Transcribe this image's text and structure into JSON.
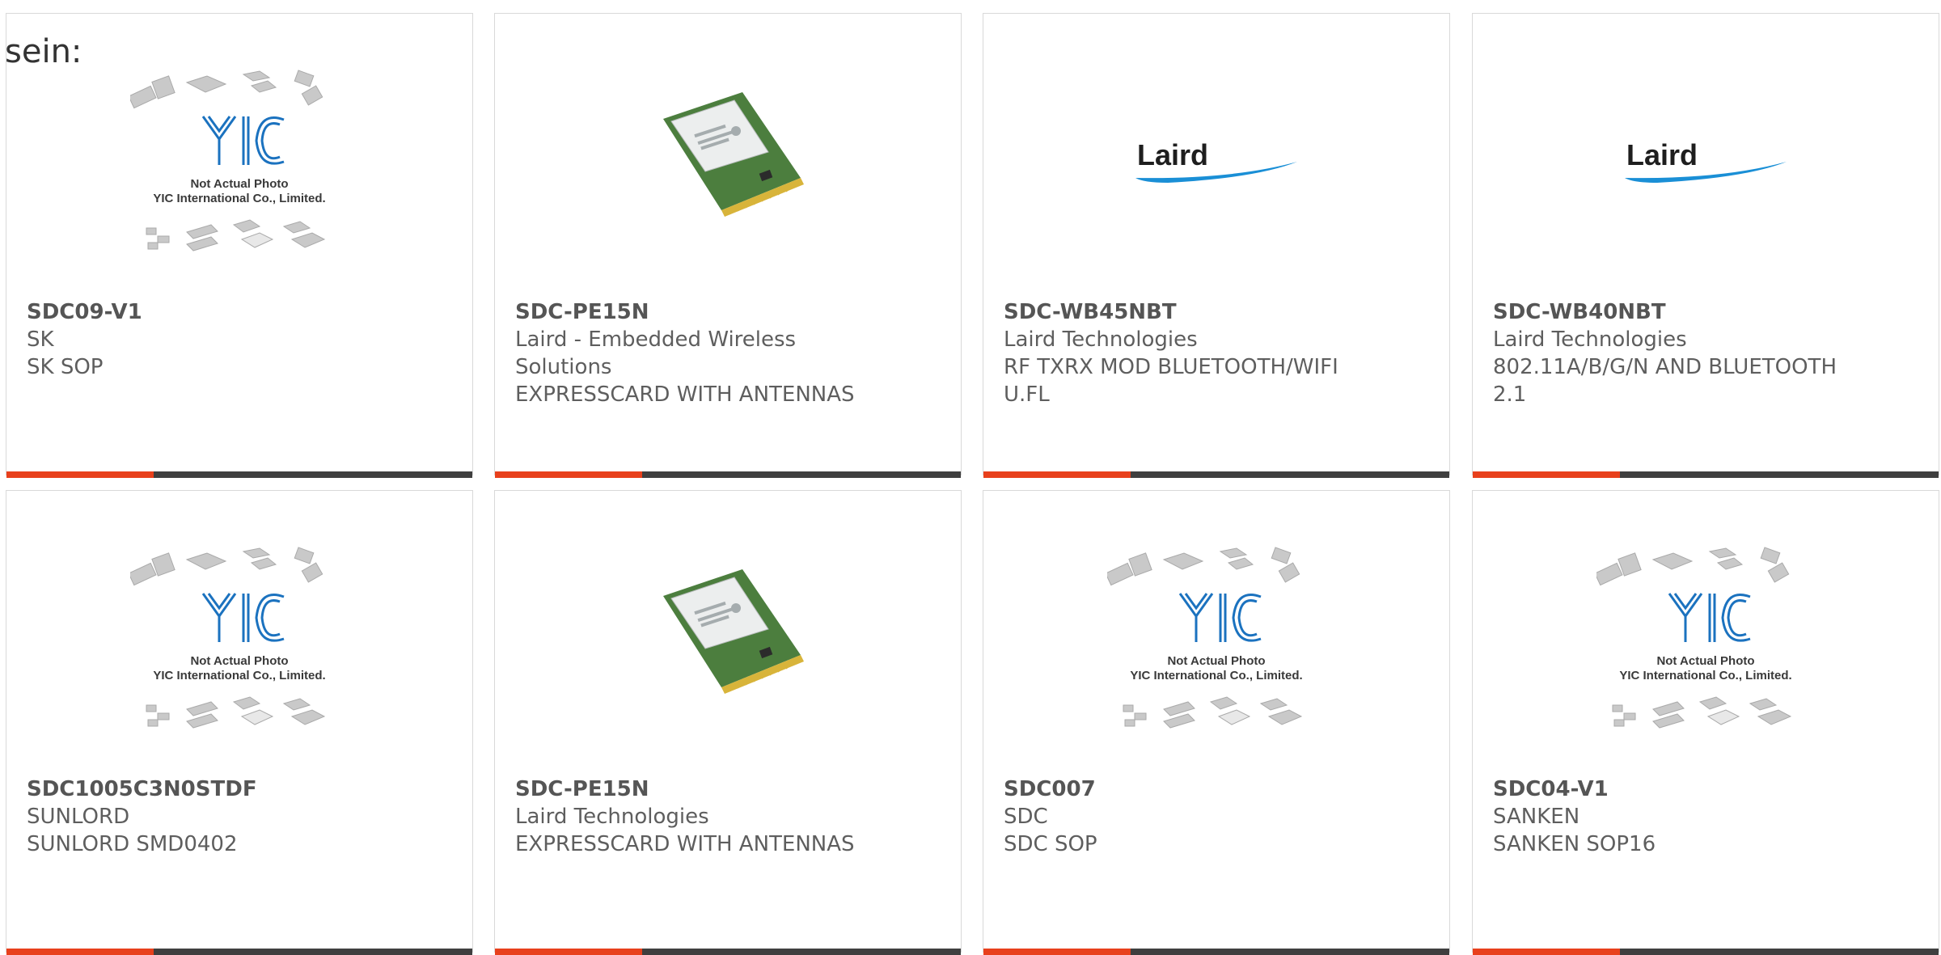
{
  "intro_text": "sein:",
  "colors": {
    "accent": "#e8401c",
    "bar_dark": "#3f3f3f",
    "yic_blue": "#1b72bf"
  },
  "placeholder_caption": [
    "Not Actual Photo",
    "YIC International Co., Limited."
  ],
  "laird_wordmark": "Laird",
  "products": [
    {
      "part": "SDC09-V1",
      "lines": [
        "SK",
        "SK SOP"
      ],
      "image": "yic-placeholder"
    },
    {
      "part": "SDC-PE15N",
      "lines": [
        "Laird - Embedded Wireless",
        "Solutions",
        "EXPRESSCARD WITH ANTENNAS"
      ],
      "image": "module-card-photo"
    },
    {
      "part": "SDC-WB45NBT",
      "lines": [
        "Laird Technologies",
        "RF TXRX MOD BLUETOOTH/WIFI",
        "U.FL"
      ],
      "image": "laird-logo"
    },
    {
      "part": "SDC-WB40NBT",
      "lines": [
        "Laird Technologies",
        "802.11A/B/G/N AND BLUETOOTH",
        "2.1"
      ],
      "image": "laird-logo"
    },
    {
      "part": "SDC1005C3N0STDF",
      "lines": [
        "SUNLORD",
        "SUNLORD SMD0402"
      ],
      "image": "yic-placeholder"
    },
    {
      "part": "SDC-PE15N",
      "lines": [
        "Laird Technologies",
        "EXPRESSCARD WITH ANTENNAS"
      ],
      "image": "module-card-photo"
    },
    {
      "part": "SDC007",
      "lines": [
        "SDC",
        "SDC SOP"
      ],
      "image": "yic-placeholder"
    },
    {
      "part": "SDC04-V1",
      "lines": [
        "SANKEN",
        "SANKEN SOP16"
      ],
      "image": "yic-placeholder"
    }
  ]
}
